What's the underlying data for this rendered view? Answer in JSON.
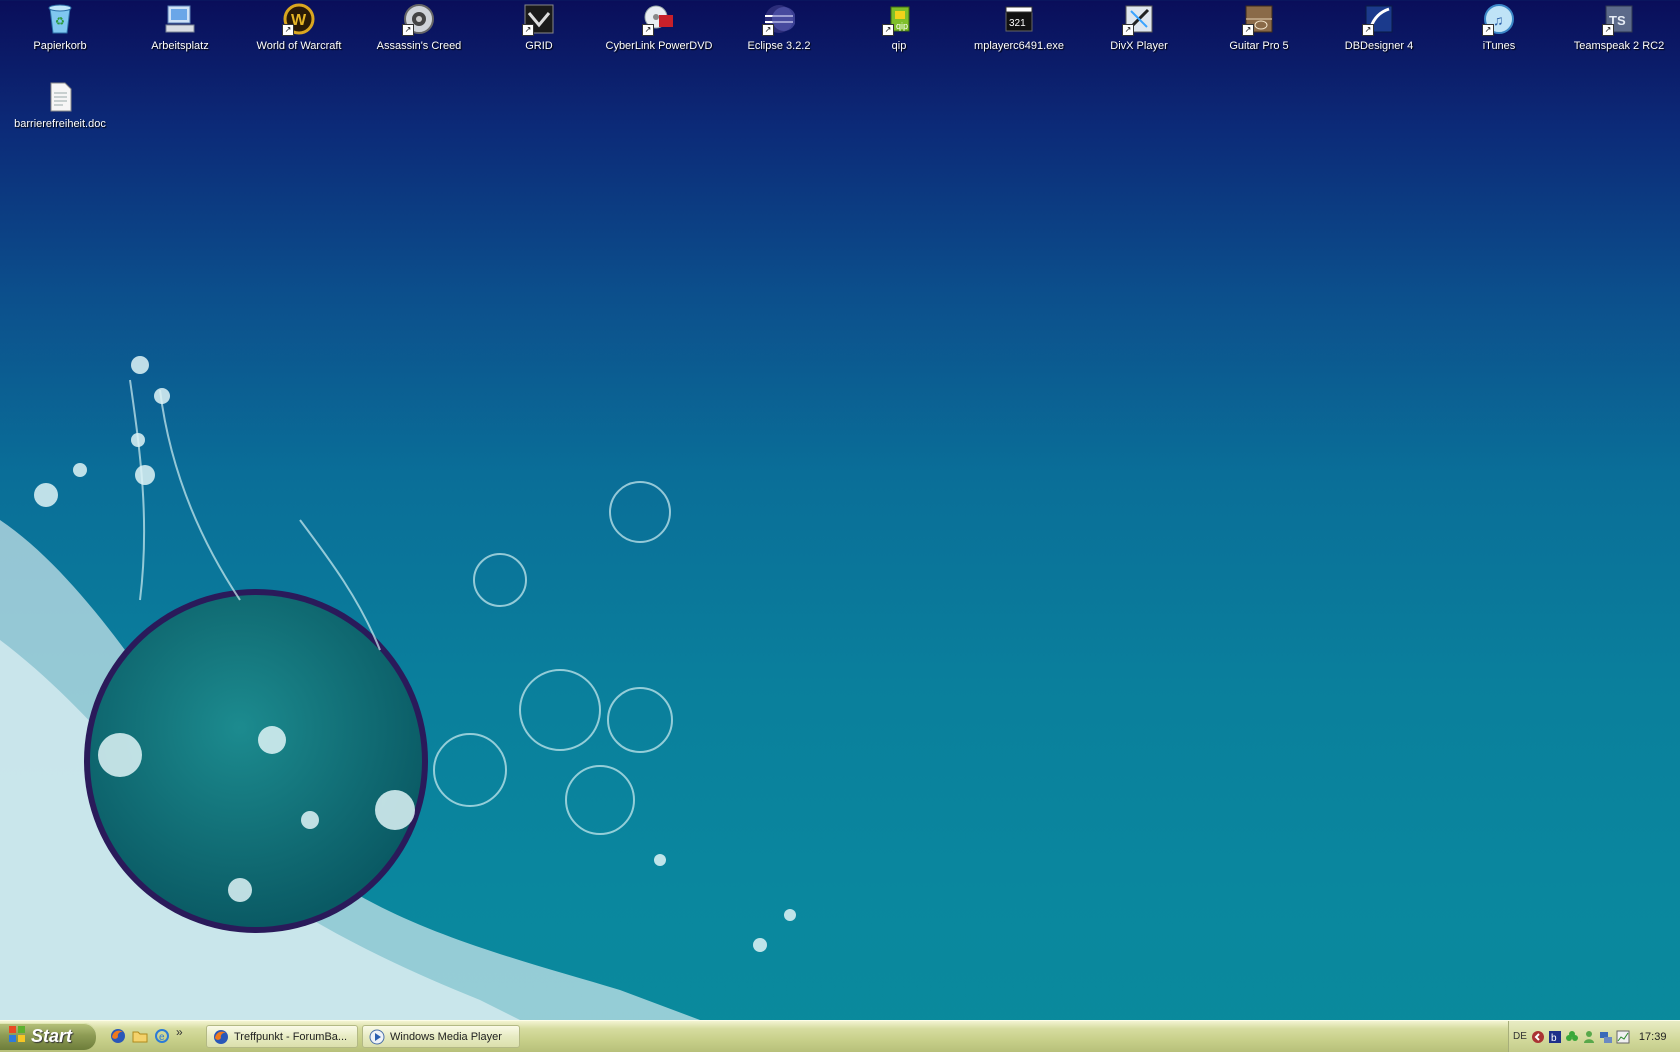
{
  "desktop": {
    "icons": [
      {
        "label": "Papierkorb",
        "icon": "recycle-bin-icon"
      },
      {
        "label": "Arbeitsplatz",
        "icon": "my-computer-icon"
      },
      {
        "label": "World of Warcraft",
        "icon": "wow-icon"
      },
      {
        "label": "Assassin's Creed",
        "icon": "assassins-creed-icon"
      },
      {
        "label": "GRID",
        "icon": "grid-game-icon"
      },
      {
        "label": "CyberLink PowerDVD",
        "icon": "powerdvd-icon"
      },
      {
        "label": "Eclipse 3.2.2",
        "icon": "eclipse-icon"
      },
      {
        "label": "qip",
        "icon": "qip-icon"
      },
      {
        "label": "mplayerc6491.exe",
        "icon": "mplayer-icon"
      },
      {
        "label": "DivX Player",
        "icon": "divx-icon"
      },
      {
        "label": "Guitar Pro 5",
        "icon": "guitar-pro-icon"
      },
      {
        "label": "DBDesigner 4",
        "icon": "dbdesigner-icon"
      },
      {
        "label": "iTunes",
        "icon": "itunes-icon"
      },
      {
        "label": "Teamspeak 2 RC2",
        "icon": "teamspeak-icon"
      },
      {
        "label": "barrierefreiheit.doc",
        "icon": "document-icon"
      }
    ]
  },
  "taskbar": {
    "start_label": "Start",
    "tasks": [
      {
        "label": "Treffpunkt - ForumBa...",
        "icon": "firefox-icon"
      },
      {
        "label": "Windows Media Player",
        "icon": "media-player-icon"
      }
    ],
    "quicklaunch_more": "»",
    "tray": {
      "language": "DE",
      "clock": "17:39"
    }
  },
  "colors": {
    "desktop_top": "#0a0e5a",
    "desktop_bottom": "#0a8a9c",
    "taskbar": "#c8d08a"
  }
}
